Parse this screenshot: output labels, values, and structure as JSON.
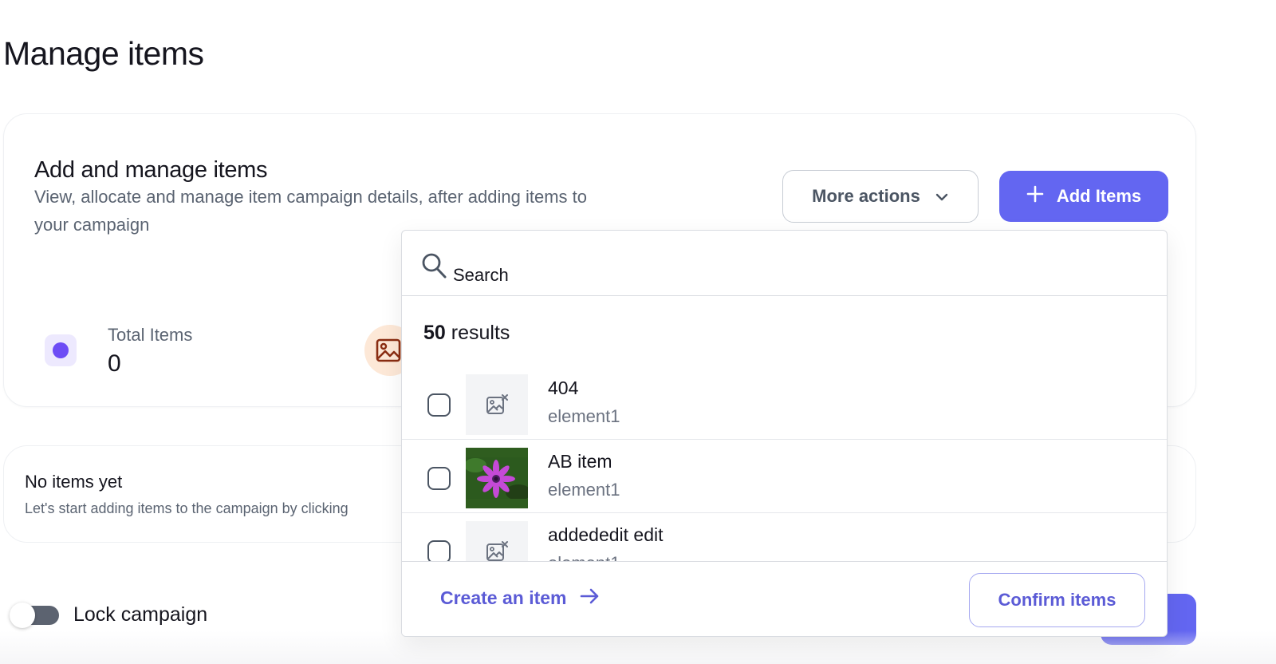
{
  "page": {
    "title": "Manage items"
  },
  "card": {
    "title": "Add and manage items",
    "description": "View, allocate and manage item campaign details, after adding items to your campaign",
    "more_actions_label": "More actions",
    "add_items_label": "Add Items",
    "stats": [
      {
        "label": "Total Items",
        "value": "0",
        "icon": "dot-icon"
      },
      {
        "icon": "image-icon"
      }
    ]
  },
  "empty_state": {
    "title": "No items yet",
    "description": "Let's start adding items to the campaign by clicking"
  },
  "lock": {
    "label": "Lock campaign",
    "enabled": false
  },
  "dropdown": {
    "search_placeholder": "Search",
    "result_count": "50",
    "result_suffix": " results",
    "items": [
      {
        "name": "404",
        "sub": "element1",
        "thumb": "no-image-icon",
        "checked": false
      },
      {
        "name": "AB item",
        "sub": "element1",
        "thumb": "flower-photo",
        "checked": false
      },
      {
        "name": "addededit edit",
        "sub": "element1",
        "thumb": "no-image-icon",
        "checked": false
      }
    ],
    "create_label": "Create an item",
    "confirm_label": "Confirm items"
  },
  "colors": {
    "accent": "#6366f1",
    "accent_text": "#5b5bd6",
    "stat_dot": "#6d4cf5"
  }
}
